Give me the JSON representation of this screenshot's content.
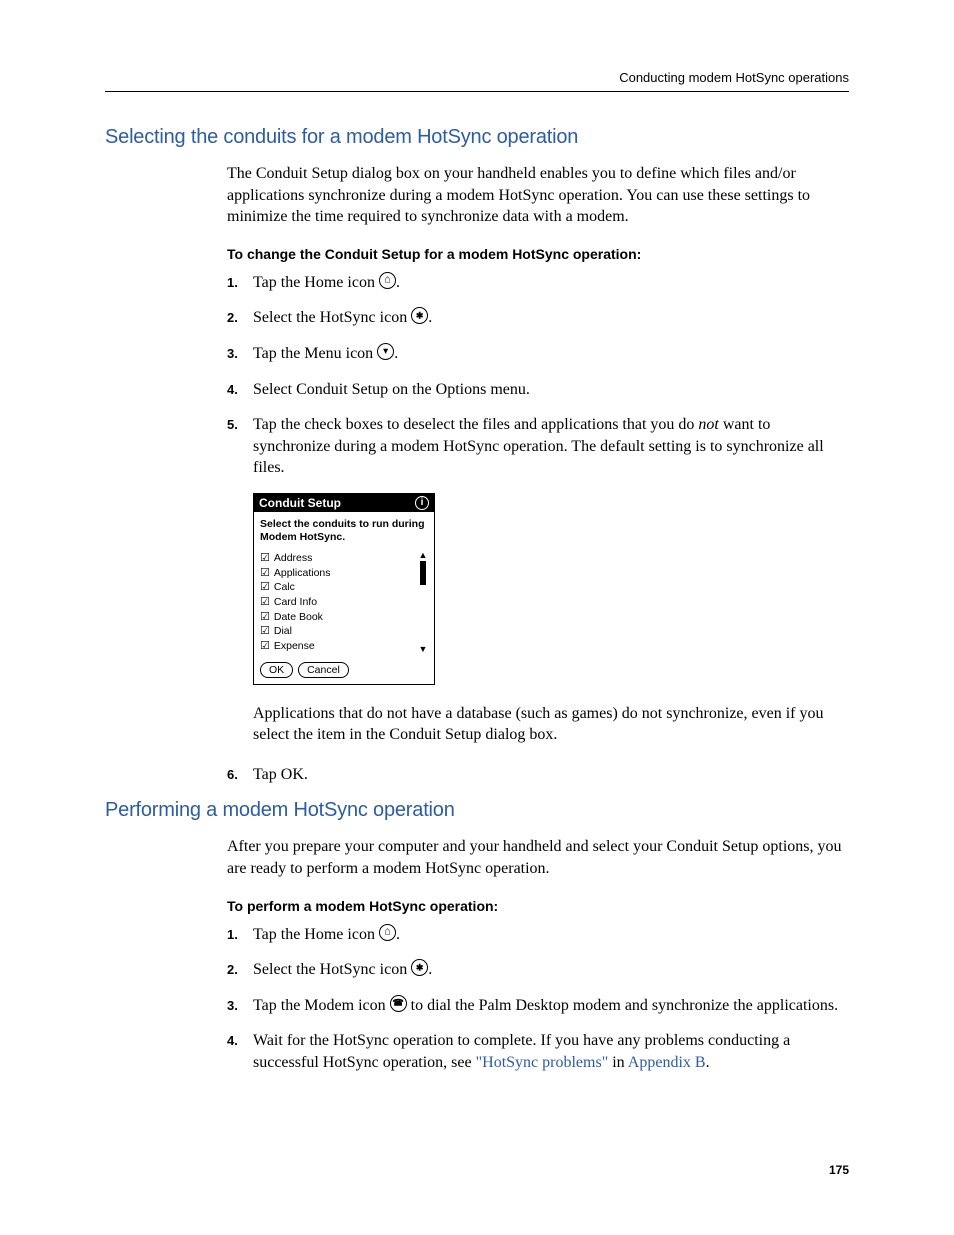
{
  "runningHead": "Conducting modem HotSync operations",
  "pageNumber": "175",
  "section1": {
    "heading": "Selecting the conduits for a modem HotSync operation",
    "intro": "The Conduit Setup dialog box on your handheld enables you to define which files and/or applications synchronize during a modem HotSync operation. You can use these settings to minimize the time required to synchronize data with a modem.",
    "subhead": "To change the Conduit Setup for a modem HotSync operation:",
    "steps": {
      "s1": {
        "num": "1.",
        "a": "Tap the Home icon ",
        "b": "."
      },
      "s2": {
        "num": "2.",
        "a": "Select the HotSync icon ",
        "b": "."
      },
      "s3": {
        "num": "3.",
        "a": "Tap the Menu icon ",
        "b": "."
      },
      "s4": {
        "num": "4.",
        "a": "Select Conduit Setup on the Options menu."
      },
      "s5": {
        "num": "5.",
        "a": "Tap the check boxes to deselect the files and applications that you do ",
        "not": "not",
        "b": " want to synchronize during a modem HotSync operation. The default setting is to synchronize all files."
      },
      "s6": {
        "num": "6.",
        "a": "Tap OK."
      }
    },
    "afterDialog": "Applications that do not have a database (such as games) do not synchronize, even if you select the item in the Conduit Setup dialog box."
  },
  "dialog": {
    "title": "Conduit Setup",
    "instruction": "Select the conduits to run during Modem HotSync.",
    "items": [
      "Address",
      "Applications",
      "Calc",
      "Card Info",
      "Date Book",
      "Dial",
      "Expense"
    ],
    "ok": "OK",
    "cancel": "Cancel"
  },
  "section2": {
    "heading": "Performing a modem HotSync operation",
    "intro": "After you prepare your computer and your handheld and select your Conduit Setup options, you are ready to perform a modem HotSync operation.",
    "subhead": "To perform a modem HotSync operation:",
    "steps": {
      "s1": {
        "num": "1.",
        "a": "Tap the Home icon ",
        "b": "."
      },
      "s2": {
        "num": "2.",
        "a": "Select the HotSync icon ",
        "b": "."
      },
      "s3": {
        "num": "3.",
        "a": "Tap the Modem icon ",
        "b": " to dial the Palm Desktop modem and synchronize the applications."
      },
      "s4": {
        "num": "4.",
        "a": "Wait for the HotSync operation to complete. If you have any problems conducting a successful HotSync operation, see ",
        "link1": "\"HotSync problems\"",
        "mid": " in ",
        "link2": "Appendix B",
        "end": "."
      }
    }
  }
}
